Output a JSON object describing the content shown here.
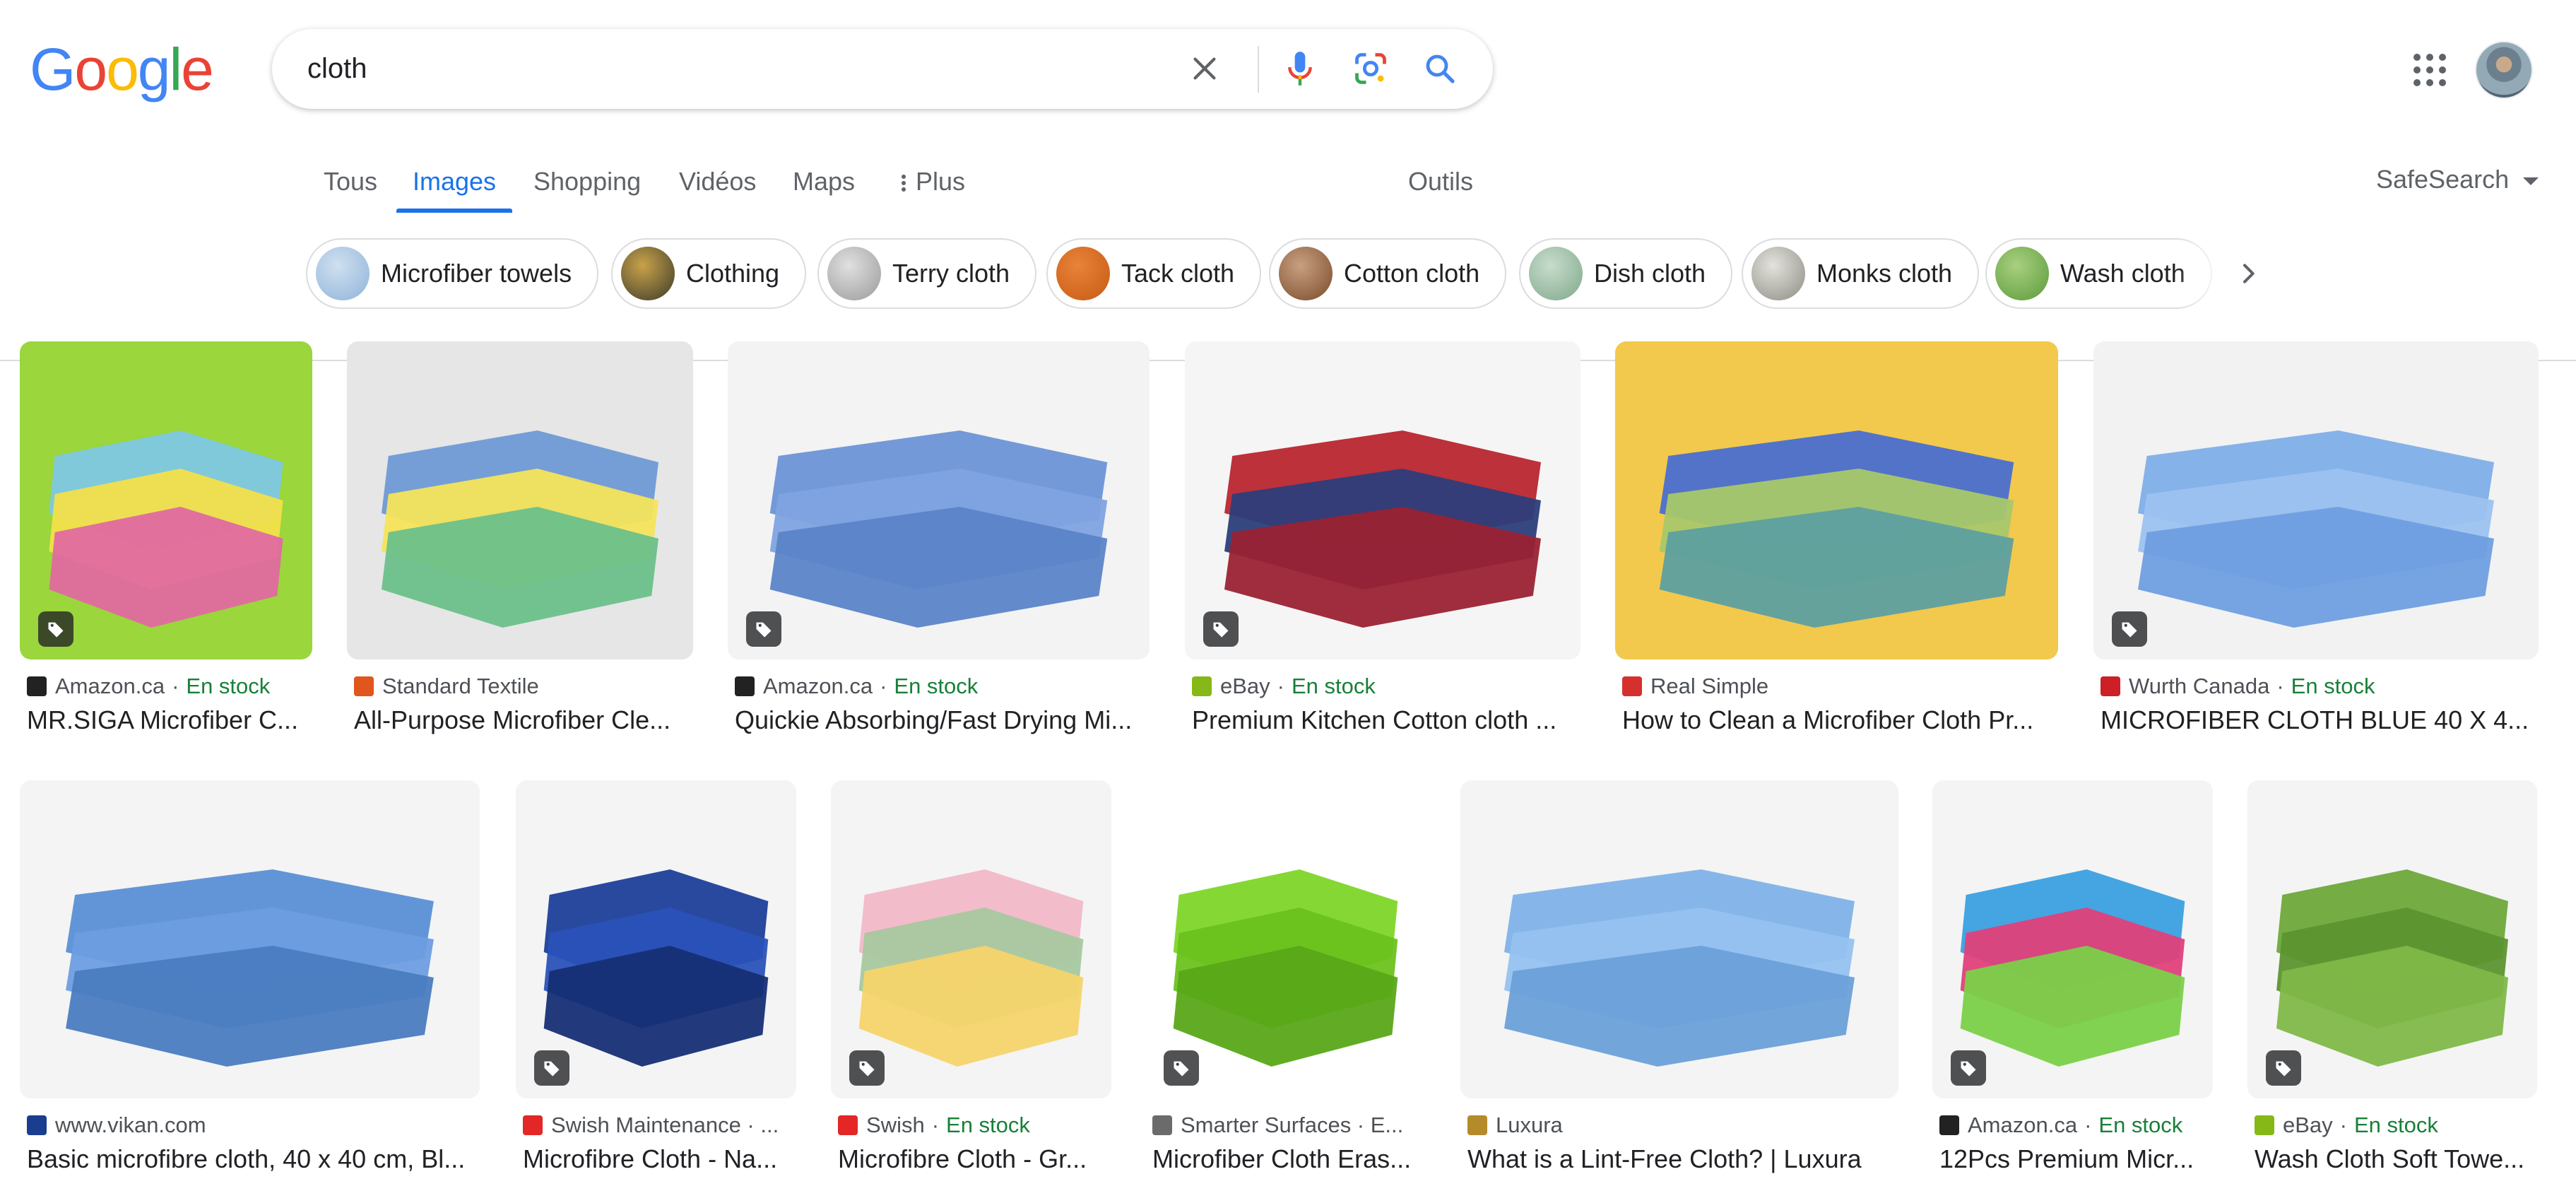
{
  "search": {
    "query": "cloth"
  },
  "logo": {
    "letters": [
      "G",
      "o",
      "o",
      "g",
      "l",
      "e"
    ]
  },
  "tabs": [
    {
      "label": "Tous"
    },
    {
      "label": "Images"
    },
    {
      "label": "Shopping"
    },
    {
      "label": "Vidéos"
    },
    {
      "label": "Maps"
    },
    {
      "label": "Plus"
    }
  ],
  "tools_label": "Outils",
  "safesearch_label": "SafeSearch",
  "chips": [
    {
      "label": "Microfiber towels",
      "colors": [
        "#8fb3d9",
        "#cfe0f0"
      ]
    },
    {
      "label": "Clothing",
      "colors": [
        "#3a3a2a",
        "#c9a24a"
      ]
    },
    {
      "label": "Terry cloth",
      "colors": [
        "#9a9a9a",
        "#e0e0e0"
      ]
    },
    {
      "label": "Tack cloth",
      "colors": [
        "#c85a12",
        "#e8833a"
      ]
    },
    {
      "label": "Cotton cloth",
      "colors": [
        "#7a4a2a",
        "#c8a080"
      ]
    },
    {
      "label": "Dish cloth",
      "colors": [
        "#7fa88a",
        "#c8dccd"
      ]
    },
    {
      "label": "Monks cloth",
      "colors": [
        "#8c8c84",
        "#e4e2dc"
      ]
    },
    {
      "label": "Wash cloth",
      "colors": [
        "#5c9a3a",
        "#a8d080"
      ]
    }
  ],
  "results_row1": [
    {
      "source": "Amazon.ca",
      "stock": "En stock",
      "title": "MR.SIGA Microfiber C...",
      "colors": [
        "#9ad63c",
        "#7ec8e3",
        "#f2e04a",
        "#e06aa0"
      ],
      "favicon": "#222222",
      "shop": true
    },
    {
      "source": "Standard Textile",
      "stock": "",
      "title": "All-Purpose Microfiber Cle...",
      "colors": [
        "#e6e6e6",
        "#6f9ad6",
        "#f4e45a",
        "#6cc08a"
      ],
      "favicon": "#e0561c",
      "shop": false
    },
    {
      "source": "Amazon.ca",
      "stock": "En stock",
      "title": "Quickie Absorbing/Fast Drying Mi...",
      "colors": [
        "#f3f3f3",
        "#6d94d6",
        "#7fa3e0",
        "#5b84c8"
      ],
      "favicon": "#222222",
      "shop": true
    },
    {
      "source": "eBay",
      "stock": "En stock",
      "title": "Premium Kitchen Cotton cloth ...",
      "colors": [
        "#f5f5f5",
        "#b8262f",
        "#2c3e7a",
        "#9a2233"
      ],
      "favicon": "#86b817",
      "shop": true
    },
    {
      "source": "Real Simple",
      "stock": "",
      "title": "How to Clean a Microfiber Cloth Pr...",
      "colors": [
        "#f2c94c",
        "#4a6fd0",
        "#a8c86a",
        "#5ea0a0"
      ],
      "favicon": "#d6302e",
      "shop": false
    },
    {
      "source": "Wurth Canada",
      "stock": "En stock",
      "title": "MICROFIBER CLOTH BLUE 40 X 4...",
      "colors": [
        "#f2f2f2",
        "#7eaee8",
        "#9cc2f0",
        "#6f9ee0"
      ],
      "favicon": "#cc1f26",
      "shop": true
    }
  ],
  "results_row2": [
    {
      "source": "www.vikan.com",
      "stock": "",
      "title": "Basic microfibre cloth, 40 x 40 cm, Bl...",
      "colors": [
        "#f4f4f4",
        "#5a8fd6",
        "#6d9de0",
        "#4a7cc0"
      ],
      "favicon": "#1a3d8f",
      "shop": false
    },
    {
      "source": "Swish Maintenance · ...",
      "stock": "",
      "title": "Microfibre Cloth - Na...",
      "colors": [
        "#f4f4f4",
        "#1e3f9a",
        "#2a52b8",
        "#162f75"
      ],
      "favicon": "#e32626",
      "shop": true
    },
    {
      "source": "Swish",
      "stock": "En stock",
      "title": "Microfibre Cloth - Gr...",
      "colors": [
        "#f4f4f4",
        "#f2b8c8",
        "#a6c8a0",
        "#f6d46a"
      ],
      "favicon": "#e32626",
      "shop": true
    },
    {
      "source": "Smarter Surfaces · E...",
      "stock": "",
      "title": "Microfiber Cloth Eras...",
      "colors": [
        "#ffffff",
        "#7ed628",
        "#6bc21e",
        "#58a818"
      ],
      "favicon": "#6b6b6b",
      "shop": true
    },
    {
      "source": "Luxura",
      "stock": "",
      "title": "What is a Lint-Free Cloth? | Luxura",
      "colors": [
        "#f4f4f4",
        "#7fb2e8",
        "#95c2f0",
        "#6aa0d8"
      ],
      "favicon": "#b58a2a",
      "shop": false
    },
    {
      "source": "Amazon.ca",
      "stock": "En stock",
      "title": "12Pcs Premium Micr...",
      "colors": [
        "#f4f4f4",
        "#3aa0e0",
        "#e0407a",
        "#7ad048"
      ],
      "favicon": "#222222",
      "shop": true
    },
    {
      "source": "eBay",
      "stock": "En stock",
      "title": "Wash Cloth Soft Towe...",
      "colors": [
        "#f4f4f4",
        "#6ea83a",
        "#5c9530",
        "#7fb848"
      ],
      "favicon": "#86b817",
      "shop": true
    }
  ]
}
